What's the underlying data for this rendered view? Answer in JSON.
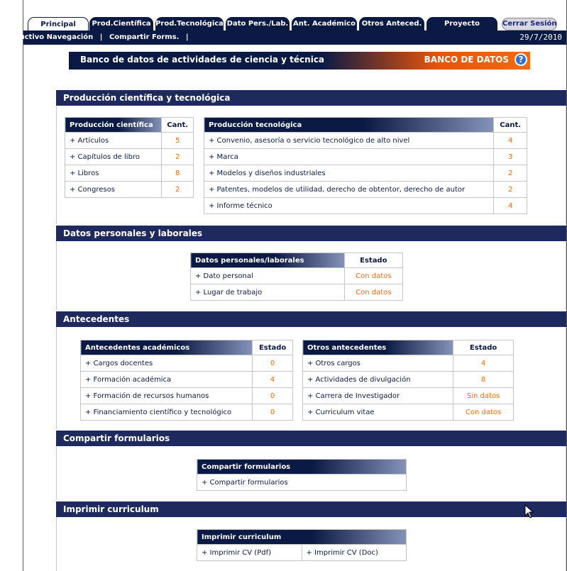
{
  "tabs": [
    "Principal",
    "Prod.Científica",
    "Prod.Tecnológica",
    "Dato Pers./Lab.",
    "Ant. Académico",
    "Otros Anteced.",
    "Proyecto"
  ],
  "logout": "Cerrar Sesión",
  "nav": {
    "instructivo": "Instructivo Navegación",
    "compartir": "Compartir Forms.",
    "sep": "|",
    "date": "29/7/2010"
  },
  "banner": {
    "title": "Banco de datos de actividades de ciencia y técnica",
    "brand": "BANCO DE DATOS",
    "help": "?"
  },
  "sections": {
    "produccion": "Producción científica y tecnológica",
    "datos": "Datos personales y laborales",
    "antecedentes": "Antecedentes",
    "compartir": "Compartir formularios",
    "imprimir": "Imprimir curriculum"
  },
  "prod_cientifica": {
    "header": "Producción científica",
    "col": "Cant.",
    "rows": [
      [
        "+ Artículos",
        "5"
      ],
      [
        "+ Capítulos de libro",
        "2"
      ],
      [
        "+ Libros",
        "8"
      ],
      [
        "+ Congresos",
        "2"
      ]
    ]
  },
  "prod_tecnologica": {
    "header": "Producción tecnológica",
    "col": "Cant.",
    "rows": [
      [
        "+ Convenio, asesoría o servicio tecnológico de alto nivel",
        "4"
      ],
      [
        "+ Marca",
        "3"
      ],
      [
        "+ Modelos y diseños industriales",
        "2"
      ],
      [
        "+ Patentes, modelos de utilidad, derecho de obtentor, derecho de autor",
        "2"
      ],
      [
        "+ Informe técnico",
        "4"
      ]
    ]
  },
  "datos_personales": {
    "header": "Datos personales/laborales",
    "col": "Estado",
    "rows": [
      [
        "+ Dato personal",
        "Con datos"
      ],
      [
        "+ Lugar de trabajo",
        "Con datos"
      ]
    ]
  },
  "ant_academicos": {
    "header": "Antecedentes académicos",
    "col": "Estado",
    "rows": [
      [
        "+ Cargos docentes",
        "0"
      ],
      [
        "+ Formación académica",
        "4"
      ],
      [
        "+ Formación de recursos humanos",
        "0"
      ],
      [
        "+ Financiamiento científico y tecnológico",
        "0"
      ]
    ]
  },
  "otros_ant": {
    "header": "Otros antecedentes",
    "col": "Estado",
    "rows": [
      [
        "+ Otros cargos",
        "4"
      ],
      [
        "+ Actividades de divulgación",
        "8"
      ],
      [
        "+ Carrera de Investigador",
        "Sin datos"
      ],
      [
        "+ Curriculum vitae",
        "Con datos"
      ]
    ]
  },
  "compartir_tbl": {
    "header": "Compartir formularios",
    "rows": [
      "+ Compartir formularios"
    ]
  },
  "imprimir_tbl": {
    "header": "Imprimir curriculum",
    "rows": [
      "+ Imprimir CV (Pdf)",
      "+ Imprimir CV (Doc)"
    ]
  }
}
